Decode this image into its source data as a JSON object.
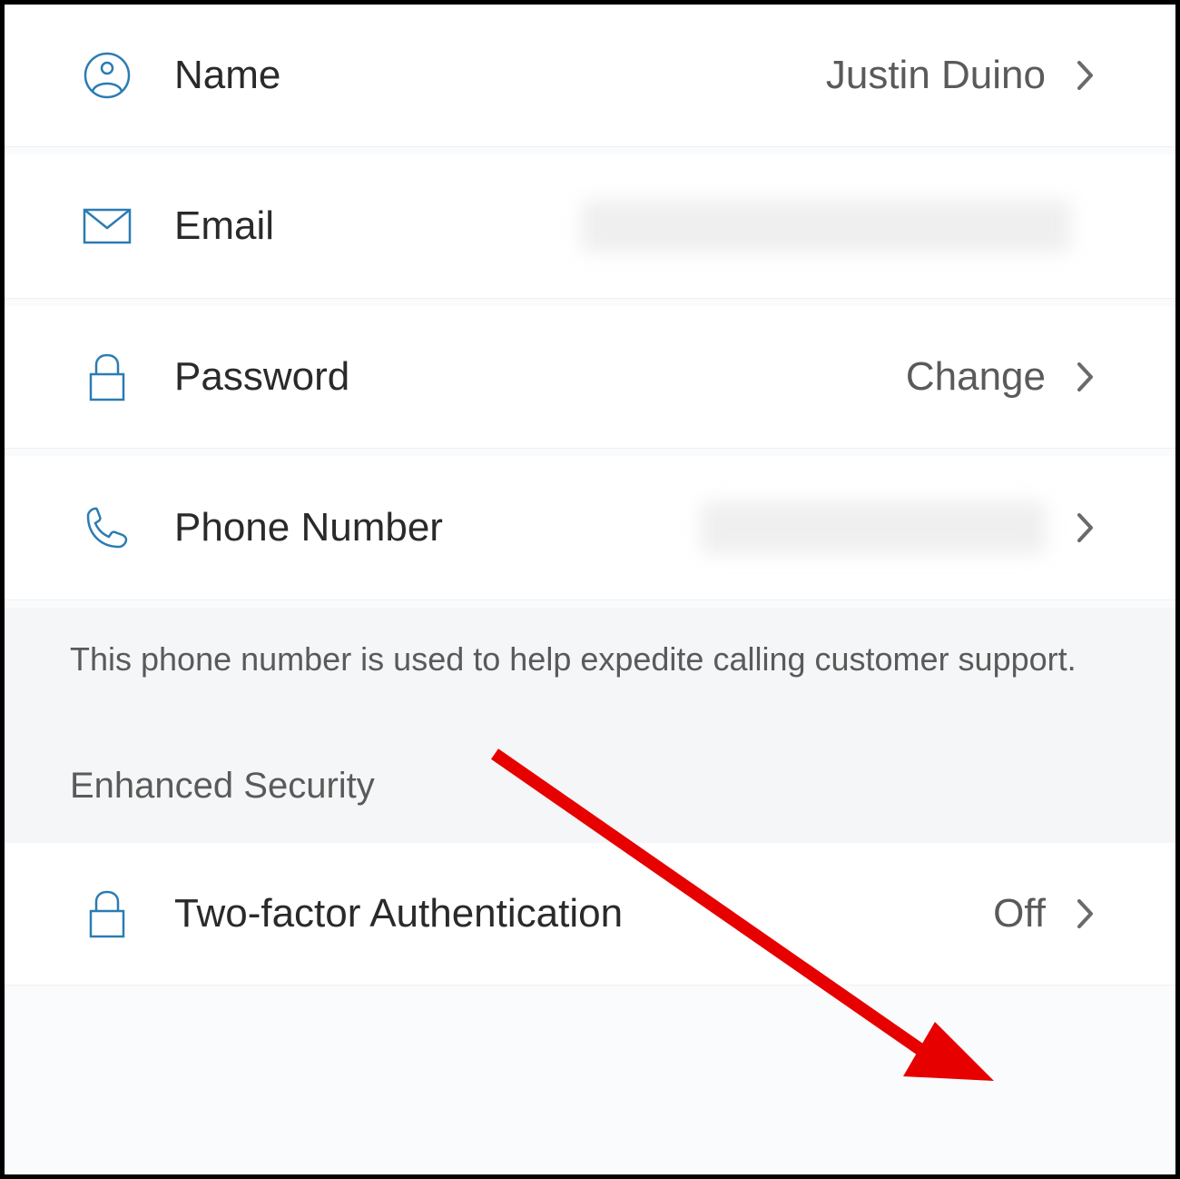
{
  "rows": {
    "name": {
      "label": "Name",
      "value": "Justin Duino"
    },
    "email": {
      "label": "Email"
    },
    "password": {
      "label": "Password",
      "value": "Change"
    },
    "phone": {
      "label": "Phone Number"
    },
    "twofa": {
      "label": "Two-factor Authentication",
      "value": "Off"
    }
  },
  "info_text": "This phone number is used to help expedite calling customer support.",
  "section_header": "Enhanced Security",
  "colors": {
    "icon_stroke": "#2b7cb3",
    "chevron": "#6a6a6a",
    "arrow": "#e60000"
  }
}
